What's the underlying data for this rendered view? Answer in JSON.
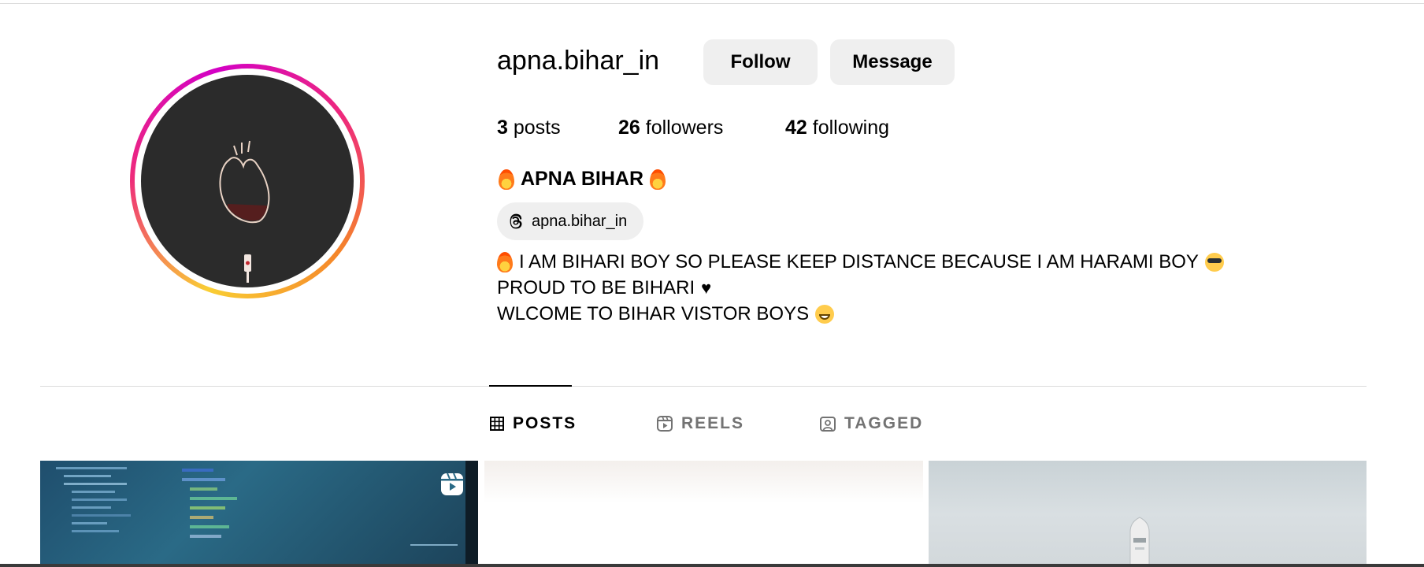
{
  "profile": {
    "username": "apna.bihar_in",
    "follow_label": "Follow",
    "message_label": "Message",
    "stats": {
      "posts_count": "3",
      "posts_label": "posts",
      "followers_count": "26",
      "followers_label": "followers",
      "following_count": "42",
      "following_label": "following"
    },
    "full_name": "APNA BIHAR",
    "threads_handle": "apna.bihar_in",
    "bio": {
      "line1": "I AM BIHARI BOY SO PLEASE KEEP DISTANCE BECAUSE I AM HARAMI BOY",
      "line2": "PROUD TO BE BIHARI",
      "line3": "WLCOME TO BIHAR VISTOR BOYS"
    },
    "avatar_icon": "heart-anatomy-icon"
  },
  "tabs": [
    {
      "label": "POSTS",
      "icon": "grid-icon",
      "active": true
    },
    {
      "label": "REELS",
      "icon": "reels-icon",
      "active": false
    },
    {
      "label": "TAGGED",
      "icon": "tagged-icon",
      "active": false
    }
  ],
  "posts": [
    {
      "type": "reel",
      "icon": "reel-badge-icon",
      "theme": "code-screen"
    },
    {
      "type": "image",
      "theme": "light"
    },
    {
      "type": "image",
      "theme": "rocket"
    }
  ],
  "colors": {
    "button_bg": "#efefef",
    "divider": "#dbdbdb",
    "inactive_tab": "#737373",
    "avatar_bg": "#2b2b2b"
  }
}
